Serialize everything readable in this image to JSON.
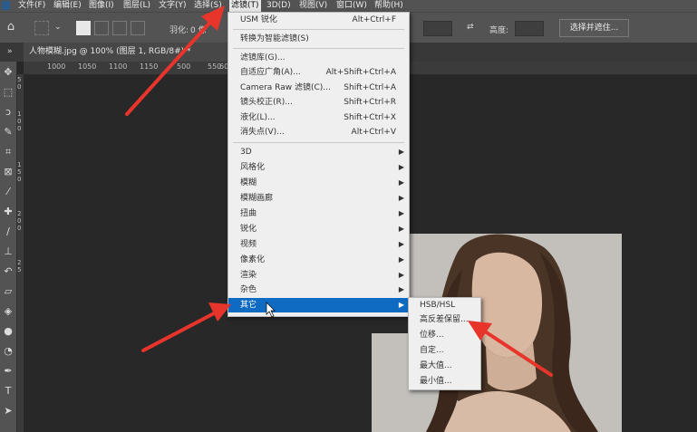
{
  "menubar": {
    "items": [
      "文件(F)",
      "编辑(E)",
      "图像(I)",
      "图层(L)",
      "文字(Y)",
      "选择(S)",
      "滤镜(T)",
      "3D(D)",
      "视图(V)",
      "窗口(W)",
      "帮助(H)"
    ],
    "active": "滤镜(T)"
  },
  "options": {
    "feather_label": "羽化:",
    "feather_value": "0 像",
    "height_label": "高度:",
    "select_mask_button": "选择并遮住..."
  },
  "document_tab": {
    "title": "人物模糊.jpg @ 100% (图层 1, RGB/8#) *"
  },
  "ruler": {
    "h_labels": [
      "1000",
      "1050",
      "1100",
      "1150",
      "500",
      "550",
      "600"
    ],
    "v_labels": [
      "5",
      "0",
      "1",
      "0",
      "0",
      "1",
      "5",
      "0",
      "2",
      "0",
      "0",
      "2",
      "5"
    ]
  },
  "filter_menu": {
    "items": [
      {
        "label": "USM 锐化",
        "shortcut": "Alt+Ctrl+F"
      },
      {
        "label": "转换为智能滤镜(S)",
        "shortcut": ""
      },
      {
        "label": "滤镜库(G)...",
        "shortcut": ""
      },
      {
        "label": "自适应广角(A)...",
        "shortcut": "Alt+Shift+Ctrl+A"
      },
      {
        "label": "Camera Raw 滤镜(C)...",
        "shortcut": "Shift+Ctrl+A"
      },
      {
        "label": "镜头校正(R)...",
        "shortcut": "Shift+Ctrl+R"
      },
      {
        "label": "液化(L)...",
        "shortcut": "Shift+Ctrl+X"
      },
      {
        "label": "消失点(V)...",
        "shortcut": "Alt+Ctrl+V"
      },
      {
        "label": "3D",
        "shortcut": ""
      },
      {
        "label": "风格化",
        "shortcut": ""
      },
      {
        "label": "模糊",
        "shortcut": ""
      },
      {
        "label": "模糊画廊",
        "shortcut": ""
      },
      {
        "label": "扭曲",
        "shortcut": ""
      },
      {
        "label": "锐化",
        "shortcut": ""
      },
      {
        "label": "视频",
        "shortcut": ""
      },
      {
        "label": "像素化",
        "shortcut": ""
      },
      {
        "label": "渲染",
        "shortcut": ""
      },
      {
        "label": "杂色",
        "shortcut": ""
      },
      {
        "label": "其它",
        "shortcut": ""
      }
    ],
    "highlighted": "其它"
  },
  "other_submenu": {
    "items": [
      "HSB/HSL",
      "高反差保留...",
      "位移...",
      "自定...",
      "最大值...",
      "最小值..."
    ]
  },
  "colors": {
    "menu_highlight": "#0f6ac1",
    "arrow": "#e8352b",
    "chrome": "#535353",
    "canvas": "#282828"
  }
}
